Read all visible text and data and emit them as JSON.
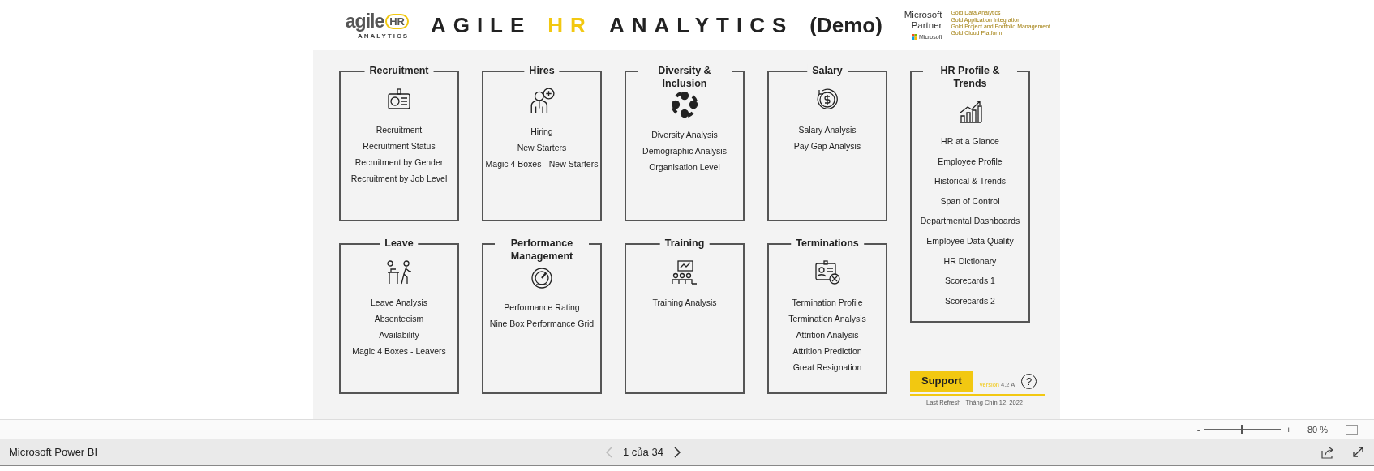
{
  "header": {
    "logo": {
      "word": "agile",
      "mark": "HR",
      "tagline": "ANALYTICS"
    },
    "title_parts": [
      {
        "text": "AGILE",
        "accent": false
      },
      {
        "text": "HR",
        "accent": true
      },
      {
        "text": "ANALYTICS",
        "accent": false
      },
      {
        "text": "(Demo)",
        "accent": false
      }
    ],
    "partner": {
      "name_lines": [
        "Microsoft",
        "Partner"
      ],
      "brand": "Microsoft",
      "competencies": [
        "Gold Data Analytics",
        "Gold Application Integration",
        "Gold Project and Portfolio Management",
        "Gold Cloud Platform"
      ]
    }
  },
  "sections": [
    {
      "title": "Recruitment",
      "items": [
        "Recruitment",
        "Recruitment Status",
        "Recruitment by Gender",
        "Recruitment by Job Level"
      ]
    },
    {
      "title": "Hires",
      "items": [
        "Hiring",
        "New Starters",
        "Magic 4 Boxes - New Starters"
      ]
    },
    {
      "title": "Diversity & Inclusion",
      "items": [
        "Diversity Analysis",
        "Demographic Analysis",
        "Organisation Level"
      ]
    },
    {
      "title": "Salary",
      "items": [
        "Salary Analysis",
        "Pay Gap Analysis"
      ]
    },
    {
      "title": "Leave",
      "items": [
        "Leave Analysis",
        "Absenteeism",
        "Availability",
        "Magic 4 Boxes - Leavers"
      ]
    },
    {
      "title": "Performance Management",
      "items": [
        "Performance Rating",
        "Nine Box Performance Grid"
      ]
    },
    {
      "title": "Training",
      "items": [
        "Training Analysis"
      ]
    },
    {
      "title": "Terminations",
      "items": [
        "Termination Profile",
        "Termination Analysis",
        "Attrition Analysis",
        "Attrition Prediction",
        "Great Resignation"
      ]
    }
  ],
  "side_section": {
    "title": "HR Profile & Trends",
    "items": [
      "HR at a Glance",
      "Employee Profile",
      "Historical & Trends",
      "Span of Control",
      "Departmental Dashboards",
      "Employee Data Quality",
      "HR Dictionary",
      "Scorecards 1",
      "Scorecards 2"
    ]
  },
  "support": {
    "button": "Support",
    "version_label": "version",
    "version": "4.2 A",
    "help": "?",
    "refresh_label": "Last Refresh",
    "refresh_date": "Tháng Chín 12, 2022"
  },
  "zoom_bar": {
    "minus": "-",
    "plus": "+",
    "level": 0.47,
    "percent": "80 %"
  },
  "status_bar": {
    "app": "Microsoft Power BI",
    "prev_disabled": true,
    "page": "1 của 34",
    "next_disabled": false
  }
}
